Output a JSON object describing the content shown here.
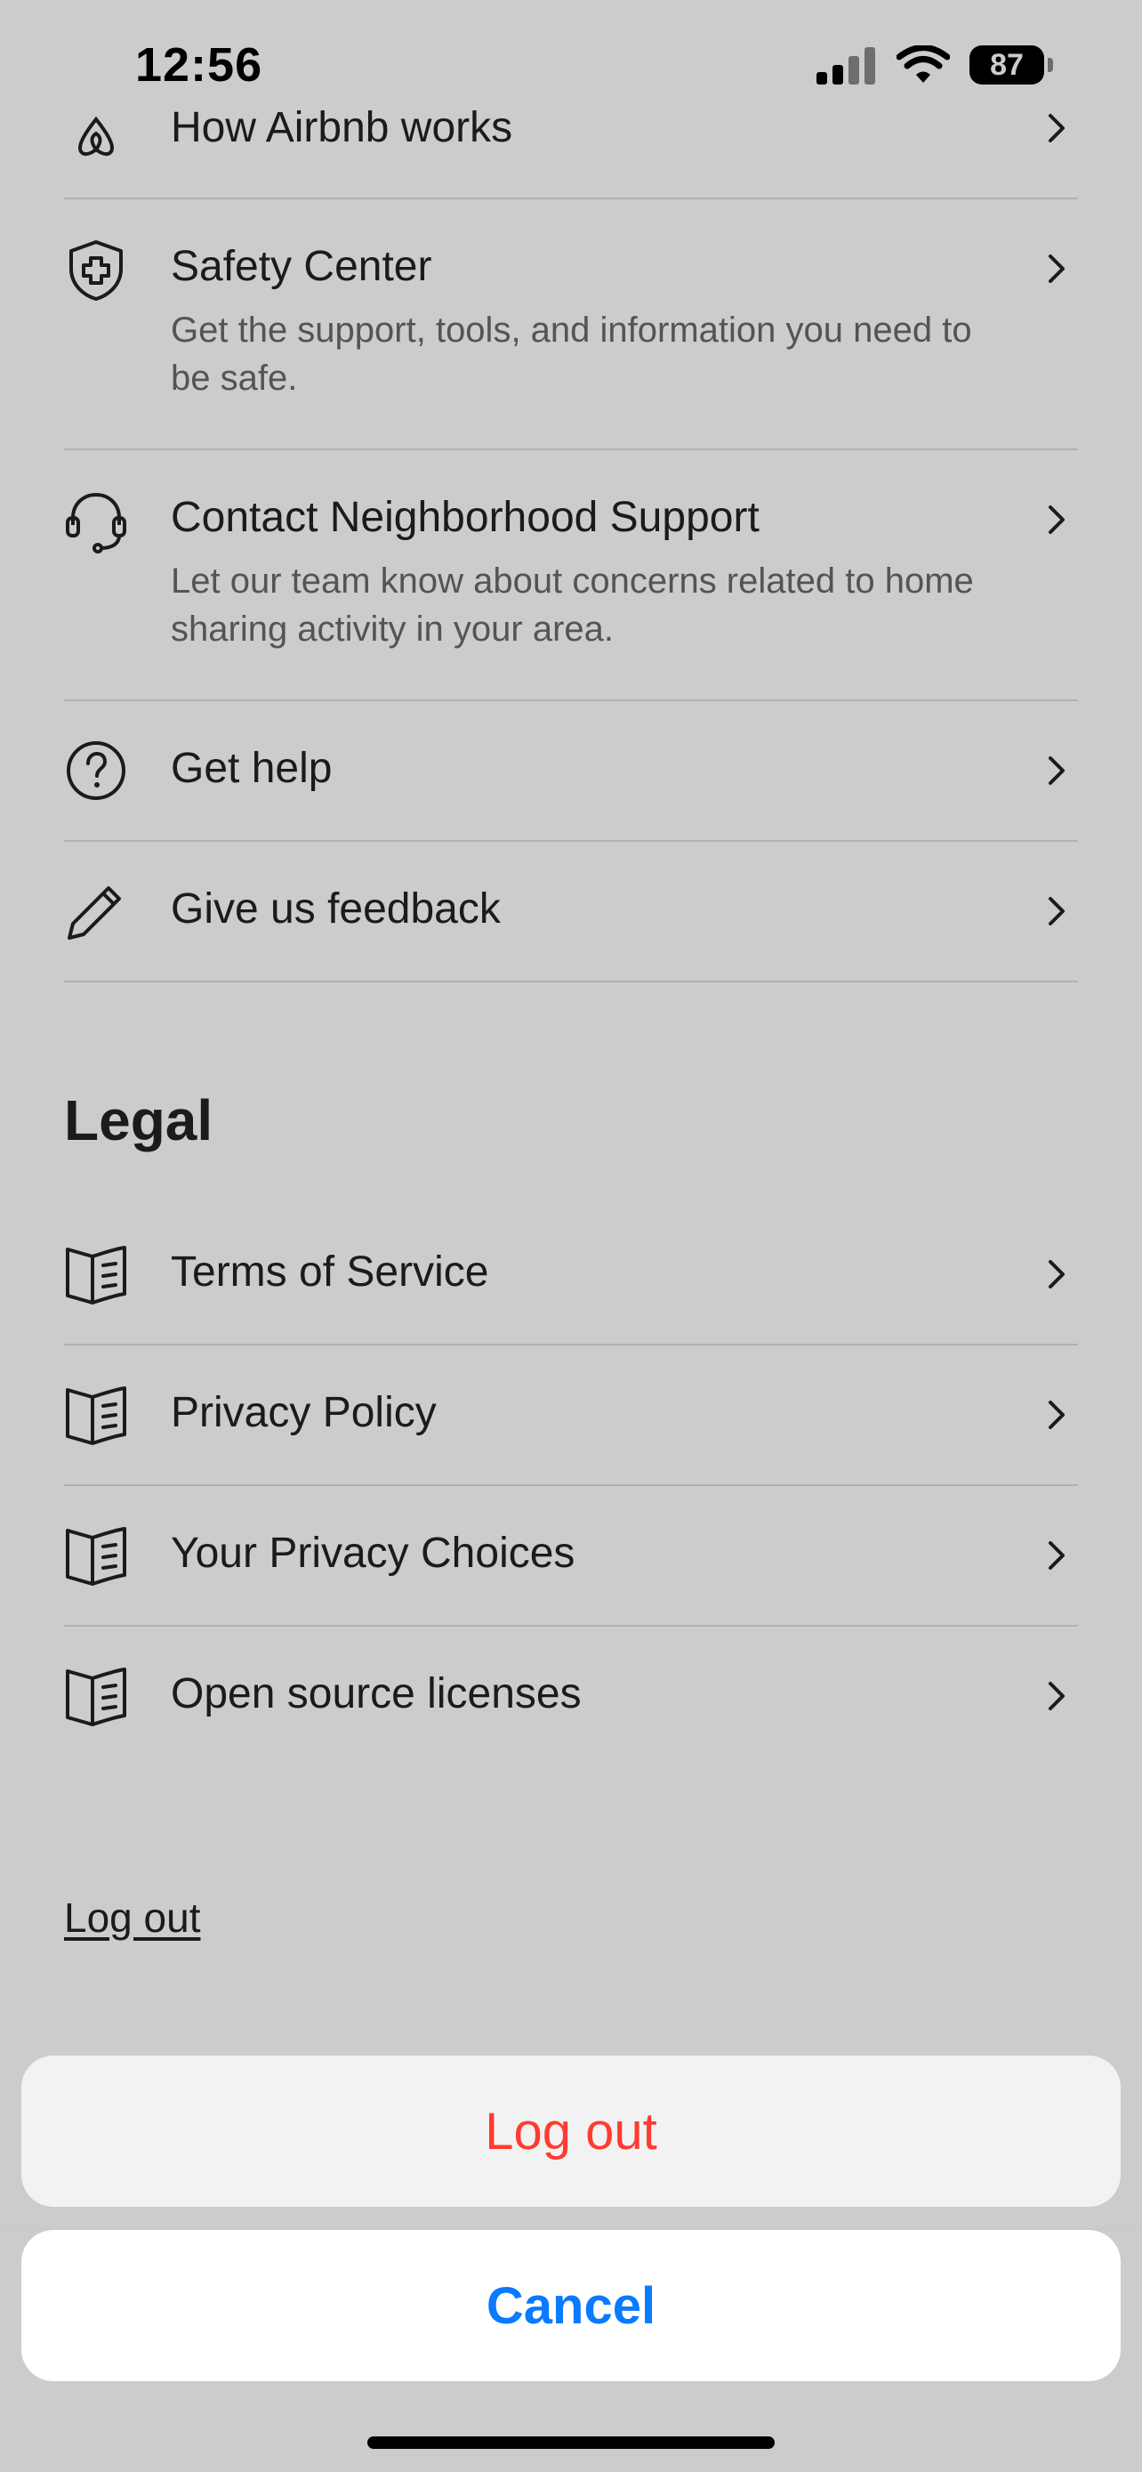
{
  "status_bar": {
    "time": "12:56",
    "battery": "87"
  },
  "support_items": [
    {
      "title": "How Airbnb works",
      "icon": "airbnb-logo-icon"
    },
    {
      "title": "Safety Center",
      "subtitle": "Get the support, tools, and information you need to be safe.",
      "icon": "shield-plus-icon"
    },
    {
      "title": "Contact Neighborhood Support",
      "subtitle": "Let our team know about concerns related to home sharing activity in your area.",
      "icon": "headset-icon"
    },
    {
      "title": "Get help",
      "icon": "question-circle-icon"
    },
    {
      "title": "Give us feedback",
      "icon": "pencil-icon"
    }
  ],
  "legal": {
    "heading": "Legal",
    "items": [
      {
        "title": "Terms of Service",
        "icon": "book-icon"
      },
      {
        "title": "Privacy Policy",
        "icon": "book-icon"
      },
      {
        "title": "Your Privacy Choices",
        "icon": "book-icon"
      },
      {
        "title": "Open source licenses",
        "icon": "book-icon"
      }
    ]
  },
  "logout_link": "Log out",
  "action_sheet": {
    "logout_label": "Log out",
    "cancel_label": "Cancel"
  },
  "colors": {
    "destructive": "#ff3b30",
    "accent": "#0a7aff",
    "overlay": "rgba(0,0,0,0.2)"
  }
}
